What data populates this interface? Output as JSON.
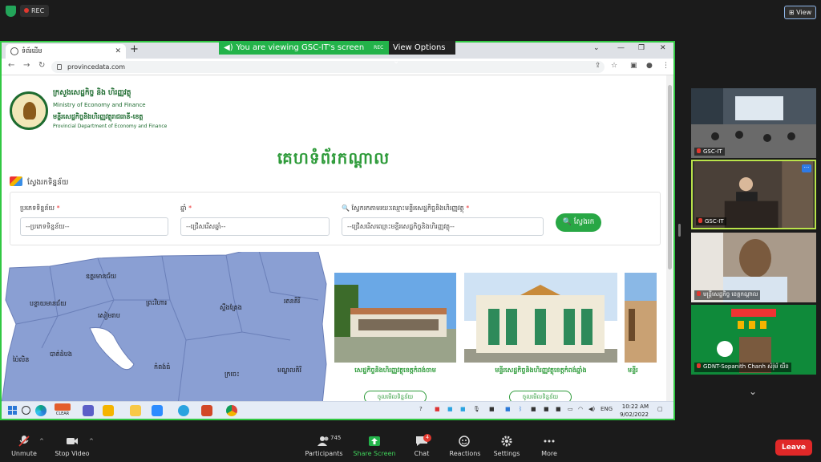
{
  "zoom": {
    "recording_label": "REC",
    "view_label": "View",
    "banner_text": "You are viewing GSC-IT's screen",
    "banner_rec": "REC",
    "view_options_label": "View Options",
    "toolbar": {
      "unmute": "Unmute",
      "stop_video": "Stop Video",
      "participants": "Participants",
      "participants_count": "745",
      "share_screen": "Share Screen",
      "chat": "Chat",
      "chat_badge": "4",
      "reactions": "Reactions",
      "settings": "Settings",
      "more": "More",
      "leave": "Leave"
    },
    "participants": [
      {
        "name": "GSC-IT",
        "scene": "conference-room"
      },
      {
        "name": "GSC-IT",
        "scene": "speaker-podium",
        "active": true
      },
      {
        "name": "មន្ត្រីសេដ្ឋកិច្ច ខេត្តកណ្តាល",
        "scene": "man-portrait"
      },
      {
        "name": "GDNT-Sopanith Chanh សំរ៉ុម័ យឹន",
        "scene": "green-slide"
      }
    ]
  },
  "browser": {
    "tab_title": "ទំព័រដើម",
    "url": "provincedata.com"
  },
  "site": {
    "ministry_kh": "ក្រសួងសេដ្ឋកិច្ច និង ហិរញ្ញវត្ថុ",
    "ministry_en": "Ministry of Economy and Finance",
    "dept_kh": "មន្ទីរសេដ្ឋកិច្ចនិងហិរញ្ញវត្ថុរាជធានី-ខេត្ត",
    "dept_en": "Provincial Department of Economy and Finance",
    "page_title": "គេហទំព័រកណ្ដាល",
    "search_heading": "ស្វែងរកទិន្នន័យ",
    "filters": {
      "type_label": "ប្រភេទទិន្នន័យ",
      "type_placeholder": "--ប្រភេទទិន្នន័យ--",
      "year_label": "ឆ្នាំ",
      "year_placeholder": "--ជ្រើសរើសឆ្នាំ--",
      "dept_label": "ស្វែករកតាមរយៈឈ្មោះមន្ទីរសេដ្ឋកិច្ចនិងហិរញ្ញវត្ថុ",
      "dept_placeholder": "--ជ្រើសរើសឈ្មោះមន្ទីរសេដ្ឋកិច្ចនិងហិរញ្ញវត្ថុ--",
      "search_button": "ស្វែងរក"
    },
    "map_labels": [
      "ឧត្តរមានជ័យ",
      "បន្ទាយមានជ័យ",
      "ព្រះវិហារ",
      "សៀមរាប",
      "ស្ទឹងត្រែង",
      "រតនគិរី",
      "បាត់ដំបង",
      "ប៉ៃលិន",
      "កំពង់ធំ",
      "ក្រចេះ",
      "មណ្ឌលគិរី"
    ],
    "cards": [
      {
        "title": "សេដ្ឋកិច្ចនិងហិរញ្ញវត្ថុខេត្តកំពង់ចាម",
        "button": "ចូលមើលទិន្នន័យ"
      },
      {
        "title": "មន្ទីរសេដ្ឋកិច្ចនិងហិរញ្ញវត្ថុខេត្តកំពង់ឆ្នាំង",
        "button": "ចូលមើលទិន្នន័យ"
      },
      {
        "title": "មន្ទីរ",
        "button": ""
      }
    ]
  },
  "taskbar": {
    "weather": "CLEAR",
    "lang": "ENG",
    "time": "10:22 AM",
    "date": "9/02/2022"
  }
}
